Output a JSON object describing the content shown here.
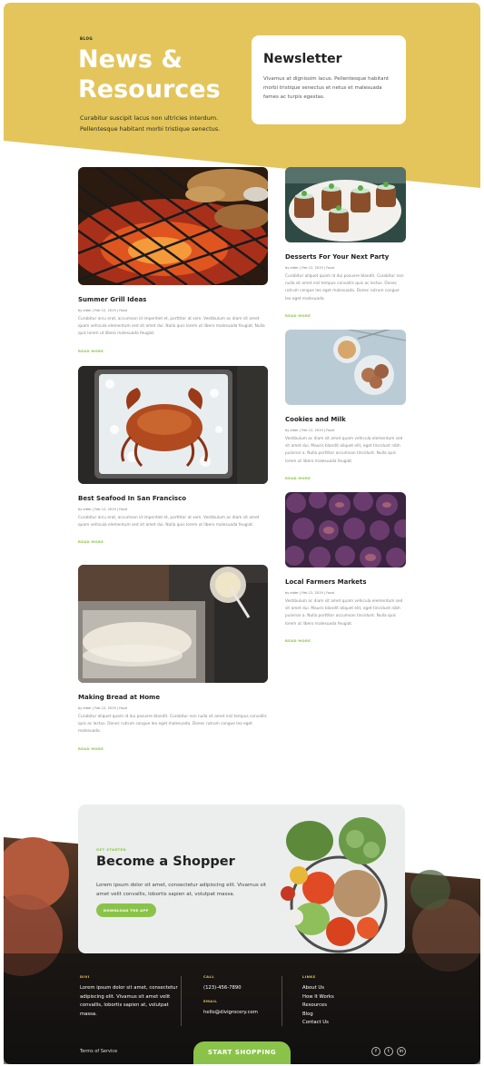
{
  "hero": {
    "eyebrow": "BLOG",
    "title": "News & Resources",
    "subtitle": "Curabitur suscipit lacus non ultricies interdum. Pellentesque habitant morbi tristique senectus."
  },
  "newsletter": {
    "title": "Newsletter",
    "text": "Vivamus at dignissim lacus. Pellentesque habitant morbi tristique senectus et netus et malesuada fames ac turpis egestas."
  },
  "posts": [
    {
      "title": "Summer Grill Ideas",
      "meta": "by elder | Feb 12, 2019 | Food",
      "excerpt": "Curabitur arcu erat, accumsan id imperdiet et, porttitor at sem. Vestibulum ac diam sit amet quam vehicula elementum sed sit amet dui. Nulla quis lorem ut libero malesuada feugiat. Nulla quis lorem ut libero malesuada feugiat.",
      "read_more": "READ MORE"
    },
    {
      "title": "Desserts For Your Next Party",
      "meta": "by elder | Feb 12, 2019 | Food",
      "excerpt": "Curabitur aliquet quam id dui posuere blandit. Curabitur non nulla sit amet nisl tempus convallis quis ac lectus. Donec rutrum congue leo eget malesuada. Donec rutrum congue leo eget malesuada.",
      "read_more": "READ MORE"
    },
    {
      "title": "Cookies and Milk",
      "meta": "by elder | Feb 12, 2019 | Food",
      "excerpt": "Vestibulum ac diam sit amet quam vehicula elementum sed sit amet dui. Mauris blandit aliquet elit, eget tincidunt nibh pulvinar a. Nulla porttitor accumsan tincidunt. Nulla quis lorem ut libero malesuada feugiat.",
      "read_more": "READ MORE"
    },
    {
      "title": "Best Seafood In San Francisco",
      "meta": "by elder | Feb 12, 2019 | Food",
      "excerpt": "Curabitur arcu erat, accumsan id imperdiet et, porttitor at sem. Vestibulum ac diam sit amet quam vehicula elementum sed sit amet dui. Nulla quis lorem ut libero malesuada feugiat.",
      "read_more": "READ MORE"
    },
    {
      "title": "Local Farmers Markets",
      "meta": "by elder | Feb 12, 2019 | Food",
      "excerpt": "Vestibulum ac diam sit amet quam vehicula elementum sed sit amet dui. Mauris blandit aliquet elit, eget tincidunt nibh pulvinar a. Nulla porttitor accumsan tincidunt. Nulla quis lorem ut libero malesuada feugiat.",
      "read_more": "READ MORE"
    },
    {
      "title": "Making Bread at Home",
      "meta": "by elder | Feb 12, 2019 | Food",
      "excerpt": "Curabitur aliquet quam id dui posuere blandit. Curabitur non nulla sit amet nisl tempus convallis quis ac lectus. Donec rutrum congue leo eget malesuada. Donec rutrum congue leo eget malesuada.",
      "read_more": "READ MORE"
    }
  ],
  "cta": {
    "eyebrow": "GET STARTED",
    "title": "Become a Shopper",
    "text": "Lorem ipsum dolor sit amet, consectetur adipiscing elit. Vivamus sit amet velit convallis, lobortis sapien at, volutpat massa.",
    "button": "DOWNLOAD THE APP"
  },
  "footer": {
    "about_label": "DIVI",
    "about_text": "Lorem ipsum dolor sit amet, consectetur adipiscing elit. Vivamus sit amet velit convallis, lobortis sapien at, volutpat massa.",
    "call_label": "CALL",
    "phone": "(123)-456-7890",
    "email_label": "EMAIL",
    "email": "hello@divigrocery.com",
    "links_label": "LINKS",
    "links": [
      "About Us",
      "How It Works",
      "Resources",
      "Blog",
      "Contact Us"
    ],
    "terms": "Terms of Service",
    "shop_button": "START SHOPPING",
    "social": [
      "facebook-icon",
      "twitter-icon",
      "linkedin-icon"
    ]
  },
  "colors": {
    "hero_yellow": "#e3c55b",
    "accent_green": "#8bc34a",
    "footer_dark": "#1b1a16"
  }
}
